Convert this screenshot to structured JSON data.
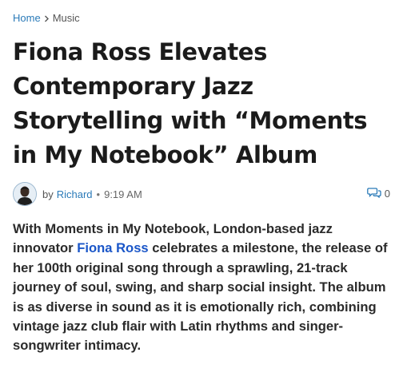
{
  "breadcrumb": {
    "home": "Home",
    "current": "Music"
  },
  "article": {
    "title": "Fiona Ross Elevates Contemporary Jazz Storytelling with “Moments in My Notebook” Album",
    "byline_prefix": "by",
    "author": "Richard",
    "separator": "•",
    "time": "9:19 AM",
    "comment_count": "0",
    "body": {
      "before_link": "With Moments in My Notebook, London-based jazz innovator ",
      "link_text": "Fiona Ross",
      "after_link": " celebrates a milestone, the release of her 100th original song through a sprawling, 21-track journey of soul, swing, and sharp social insight. The album is as diverse in sound as it is emotionally rich, combining vintage jazz club flair with Latin rhythms and singer-songwriter intimacy."
    }
  },
  "colors": {
    "link": "#2a7ab8",
    "inline_link": "#1a56c8",
    "text": "#1b1b1b"
  },
  "icons": {
    "breadcrumb_separator": "chevron-right-icon",
    "comments": "comment-bubble-icon"
  }
}
